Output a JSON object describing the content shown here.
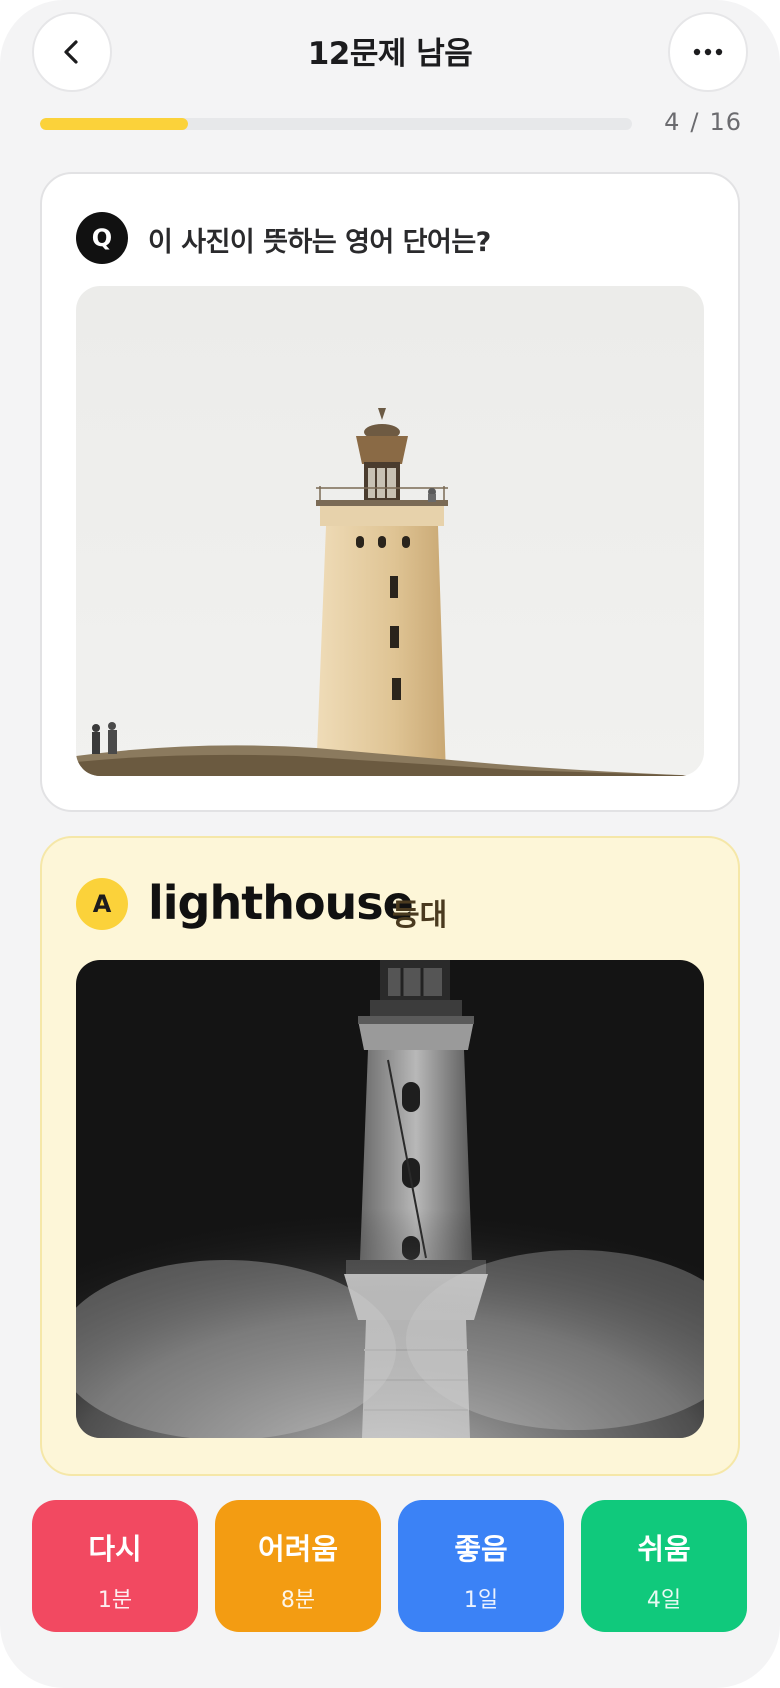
{
  "header": {
    "title": "12문제 남음",
    "back_icon": "chevron-left-icon",
    "more_icon": "more-horizontal-icon"
  },
  "progress": {
    "current": "4",
    "separator": "/",
    "total": "16",
    "fraction": 0.25,
    "color": "#fbd23a"
  },
  "question": {
    "badge": "Q",
    "text": "이 사진이 뜻하는 영어 단어는?",
    "image": "lighthouse-daytime-photo"
  },
  "answer": {
    "badge": "A",
    "word": "lighthouse",
    "meaning": "등대",
    "image": "lighthouse-night-fog-photo"
  },
  "ratings": [
    {
      "label": "다시",
      "interval": "1분",
      "color": "#f24961"
    },
    {
      "label": "어려움",
      "interval": "8분",
      "color": "#f39c12"
    },
    {
      "label": "좋음",
      "interval": "1일",
      "color": "#3b82f6"
    },
    {
      "label": "쉬움",
      "interval": "4일",
      "color": "#10c97c"
    }
  ]
}
